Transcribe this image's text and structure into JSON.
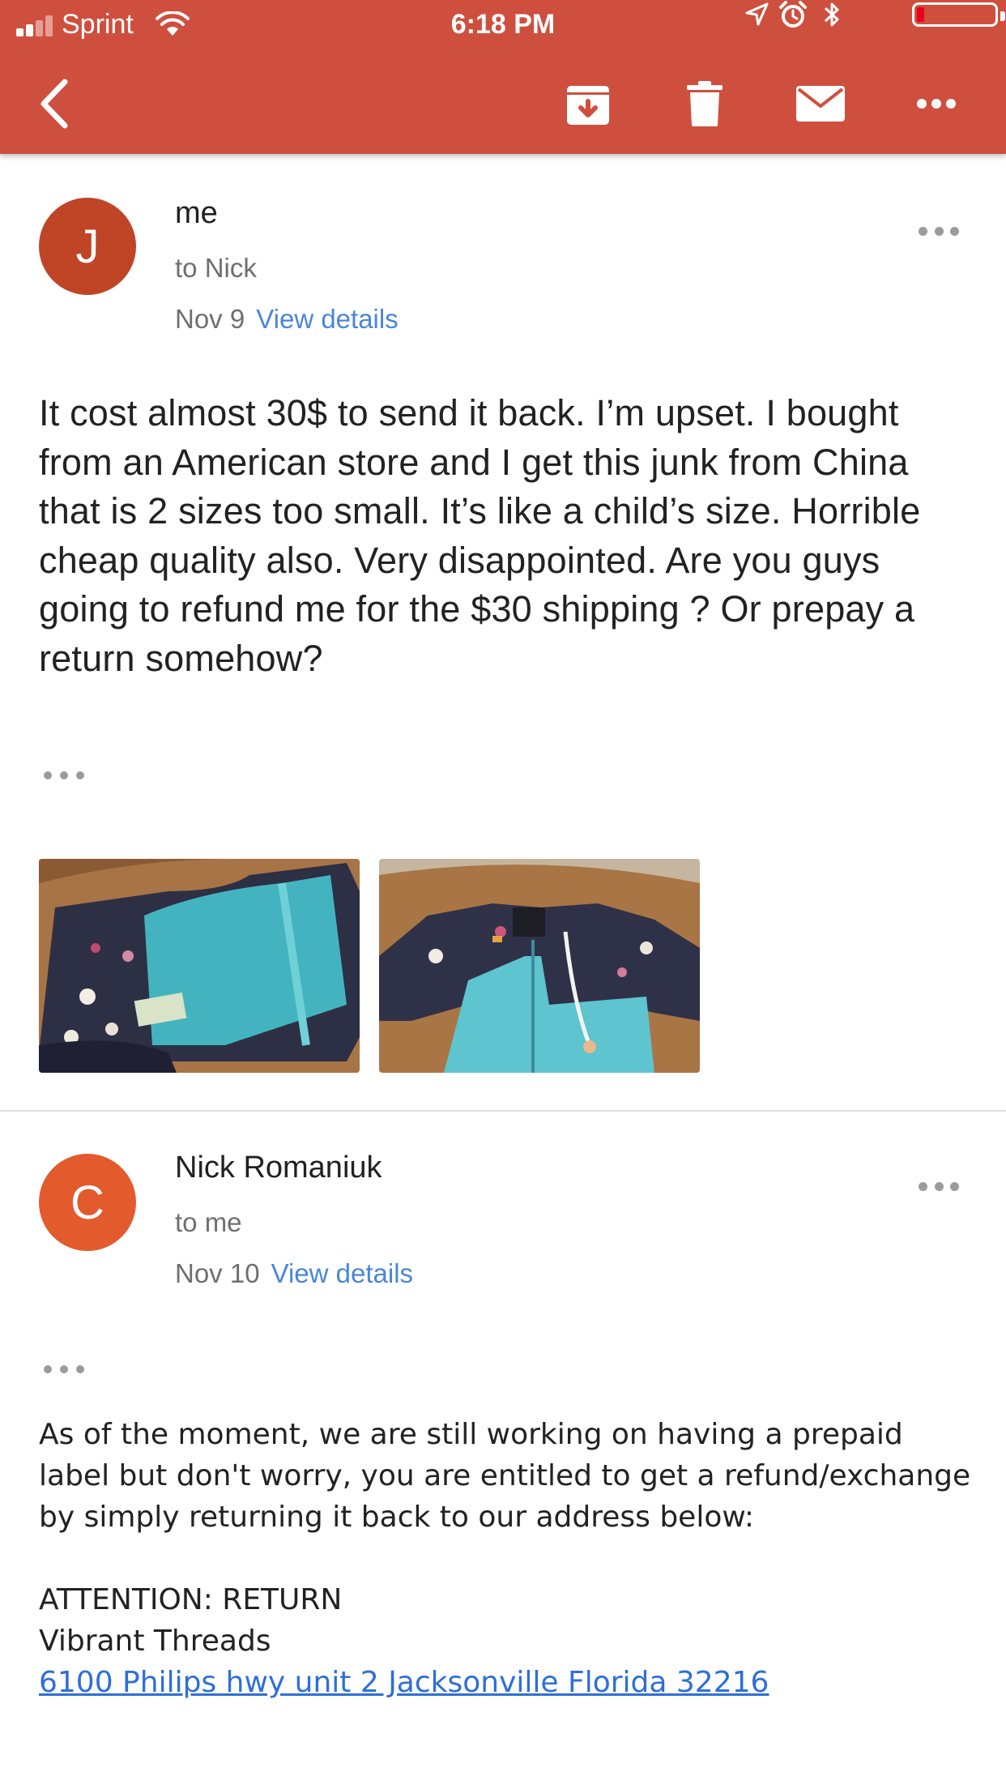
{
  "status_bar": {
    "carrier": "Sprint",
    "time": "6:18 PM",
    "battery_level": 0.1,
    "colors": {
      "battery_low": "#e8001c"
    }
  },
  "toolbar": {
    "icons": [
      "back-arrow-icon",
      "archive-icon",
      "trash-icon",
      "mail-icon",
      "more-horizontal-icon"
    ],
    "background": "#cf4f3e"
  },
  "messages": [
    {
      "avatar_letter": "J",
      "avatar_color": "#bf4526",
      "sender": "me",
      "recipient": "to Nick",
      "date": "Nov 9",
      "details_link": "View details",
      "body": "It cost almost 30$ to send it back. I’m upset. I bought from an American store and I get this junk from China that is 2 sizes too small. It’s like a child’s size. Horrible cheap quality also. Very disappointed. Are you guys going to refund me for the $30 shipping ? Or prepay a return somehow?",
      "attachments": [
        "photo of floral and teal jacket on table",
        "photo of floral and teal jacket front"
      ]
    },
    {
      "avatar_letter": "C",
      "avatar_color": "#e35a2d",
      "sender": "Nick Romaniuk",
      "recipient": "to me",
      "date": "Nov 10",
      "details_link": "View details",
      "body_paragraph": "As of the moment, we are still working on having a prepaid label but don't worry, you are entitled to get a refund/exchange by simply returning it back to our address below:",
      "attention": "ATTENTION: RETURN",
      "company": "Vibrant Threads",
      "address": "6100 Philips hwy unit 2 Jacksonville Florida 32216"
    }
  ]
}
